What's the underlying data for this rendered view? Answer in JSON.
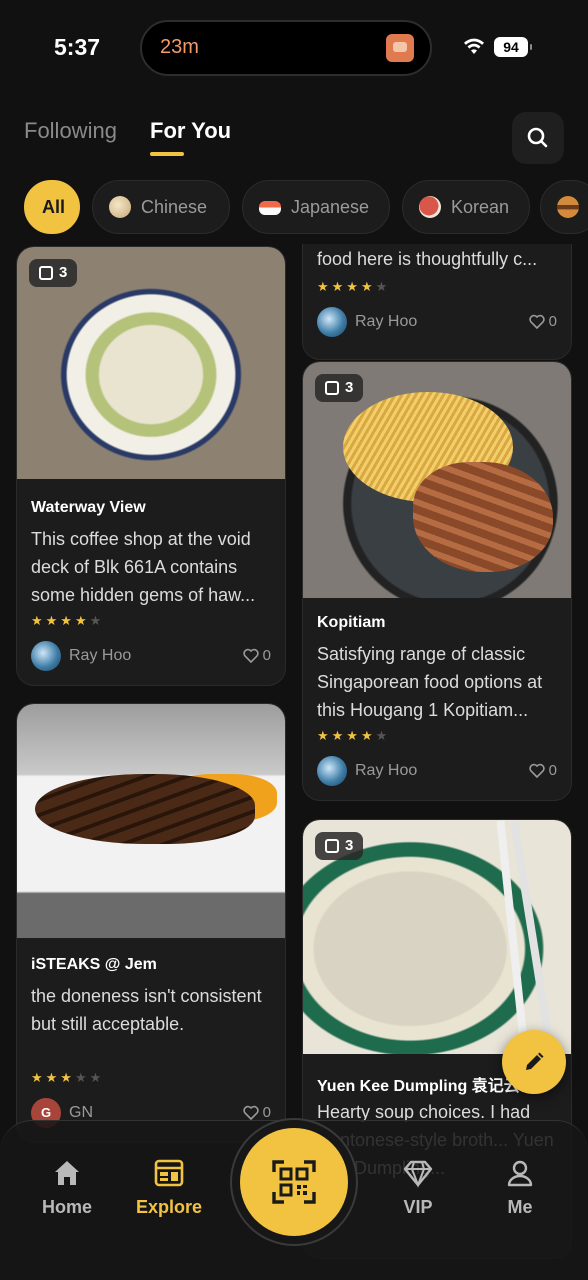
{
  "status_bar": {
    "time": "5:37",
    "live_activity": "23m",
    "battery": "94"
  },
  "top_tabs": {
    "following": "Following",
    "for_you": "For You",
    "active": "For You"
  },
  "filters": [
    {
      "label": "All",
      "active": true
    },
    {
      "label": "Chinese",
      "icon": "dumpling-icon"
    },
    {
      "label": "Japanese",
      "icon": "sushi-icon"
    },
    {
      "label": "Korean",
      "icon": "meat-icon"
    }
  ],
  "cards": [
    {
      "id": "partial-top",
      "desc": "food here is thoughtfully c...",
      "rating": 4,
      "author": "Ray Hoo",
      "likes": "0"
    },
    {
      "id": "waterway",
      "photos": "3",
      "title": "Waterway View",
      "desc": "This coffee shop at the void deck of Blk 661A contains some hidden gems of haw...",
      "rating": 4,
      "author": "Ray Hoo",
      "likes": "0"
    },
    {
      "id": "kopitiam",
      "photos": "3",
      "title": "Kopitiam",
      "desc": "Satisfying range of classic Singaporean food options at this Hougang 1 Kopitiam...",
      "rating": 4,
      "author": "Ray Hoo",
      "likes": "0"
    },
    {
      "id": "isteaks",
      "title": "iSTEAKS @ Jem",
      "desc": "the doneness isn't consistent but still acceptable.",
      "rating": 3,
      "author": "GN",
      "author_initial": "G",
      "likes": "0"
    },
    {
      "id": "yuenkee",
      "photos": "3",
      "title": "Yuen Kee Dumpling 袁记云",
      "desc": "Hearty soup choices. I had Cantonese-style broth... Yuen Kee Dumpling...",
      "author": "",
      "likes": ""
    }
  ],
  "bottom_nav": {
    "home": "Home",
    "explore": "Explore",
    "vip": "VIP",
    "me": "Me",
    "active": "Explore"
  },
  "colors": {
    "accent": "#f2c341",
    "background": "#111111",
    "card": "#1c1c1c"
  }
}
